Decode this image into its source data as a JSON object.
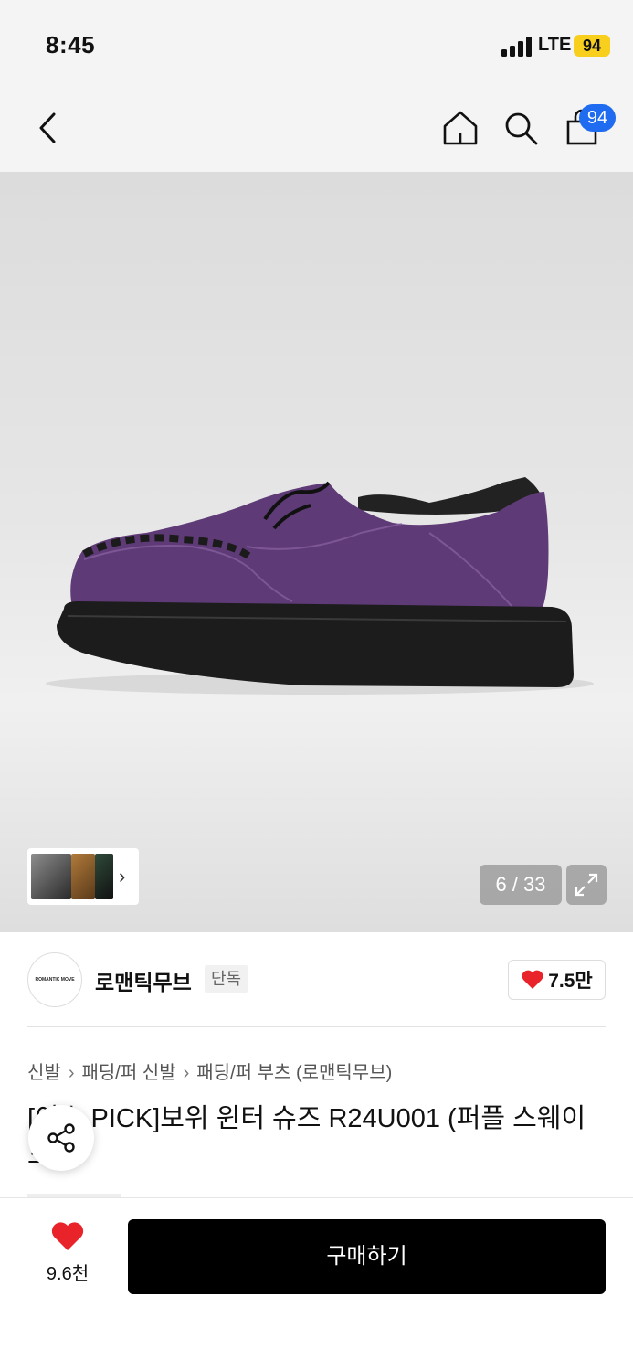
{
  "status_bar": {
    "time": "8:45",
    "network": "LTE",
    "battery": "94"
  },
  "nav": {
    "cart_badge": "94",
    "icons": [
      "chevron-left-icon",
      "home-icon",
      "search-icon",
      "shopping-bag-icon"
    ]
  },
  "gallery": {
    "counter": "6 / 33",
    "product_colors": {
      "suede": "#5e3a76",
      "sole": "#1c1c1c",
      "fur": "#222222"
    }
  },
  "brand": {
    "logo_text": "ROMANTIC MOVE",
    "name": "로맨틱무브",
    "tag": "단독",
    "likes": "7.5만"
  },
  "breadcrumb": {
    "items": [
      "신발",
      "패딩/퍼 신발",
      "패딩/퍼 부츠 (로맨틱무브)"
    ]
  },
  "product": {
    "title": "[이수 PICK]보위 윈터 슈즈 R24U001 (퍼플 스웨이드)"
  },
  "bottom_bar": {
    "wish_count": "9.6천",
    "buy_label": "구매하기"
  },
  "colors": {
    "accent_blue": "#1f6cf0",
    "heart_red": "#e8232a",
    "battery_yellow": "#f7cf1c"
  }
}
